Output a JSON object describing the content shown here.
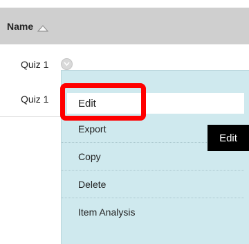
{
  "table": {
    "column_header": "Name",
    "rows": [
      {
        "label": "Quiz 1"
      },
      {
        "label": "Quiz 1"
      }
    ]
  },
  "menu": {
    "items": [
      {
        "label": "Edit"
      },
      {
        "label": "Export"
      },
      {
        "label": "Copy"
      },
      {
        "label": "Delete"
      },
      {
        "label": "Item Analysis"
      }
    ]
  },
  "tooltip": {
    "text": "Edit"
  },
  "colors": {
    "header_bg": "#cfcfcf",
    "menu_bg": "#cfe9ee",
    "highlight": "#ff0000",
    "tooltip_bg": "#000000"
  },
  "icons": {
    "sort": "sort-ascending-icon",
    "row_menu": "chevron-down-icon",
    "close": "close-icon"
  }
}
